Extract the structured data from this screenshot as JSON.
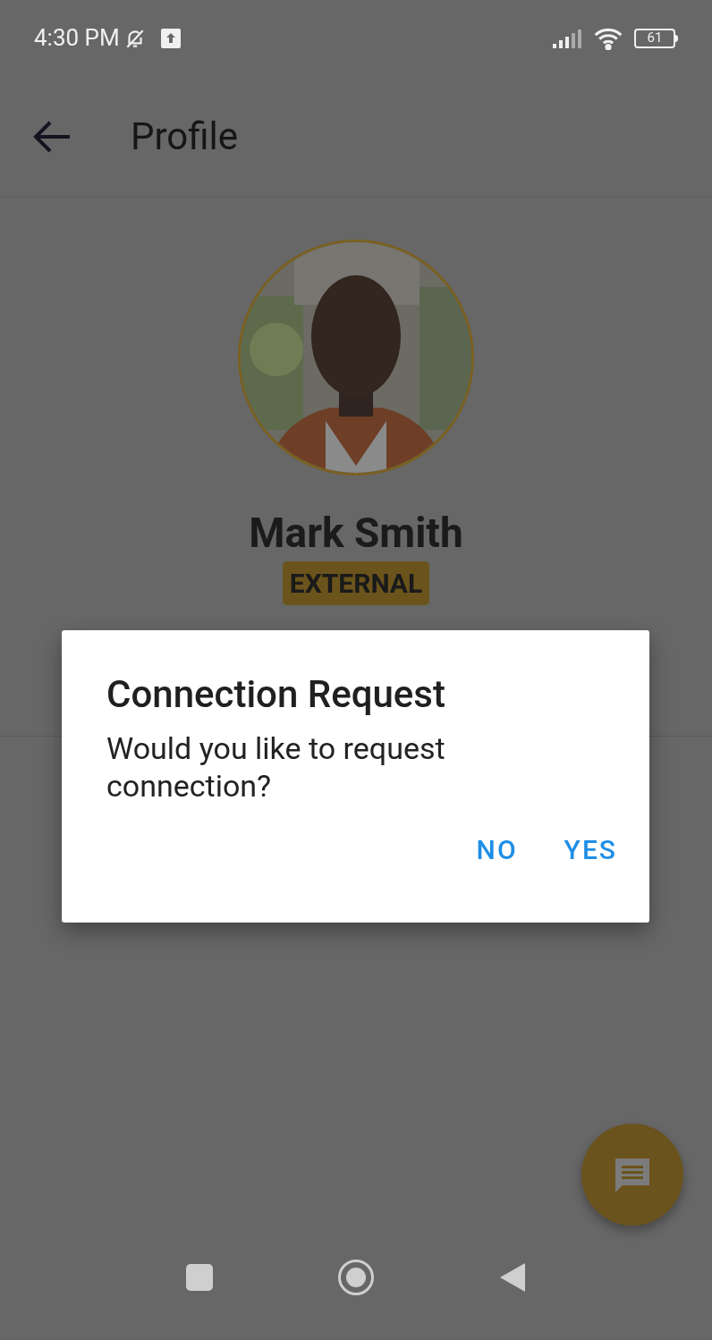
{
  "status_bar": {
    "time": "4:30 PM",
    "battery": "61"
  },
  "app_bar": {
    "title": "Profile"
  },
  "profile": {
    "name": "Mark Smith",
    "badge": "EXTERNAL"
  },
  "dialog": {
    "title": "Connection Request",
    "message": "Would you like to request connection?",
    "buttons": [
      "NO",
      "YES"
    ]
  }
}
